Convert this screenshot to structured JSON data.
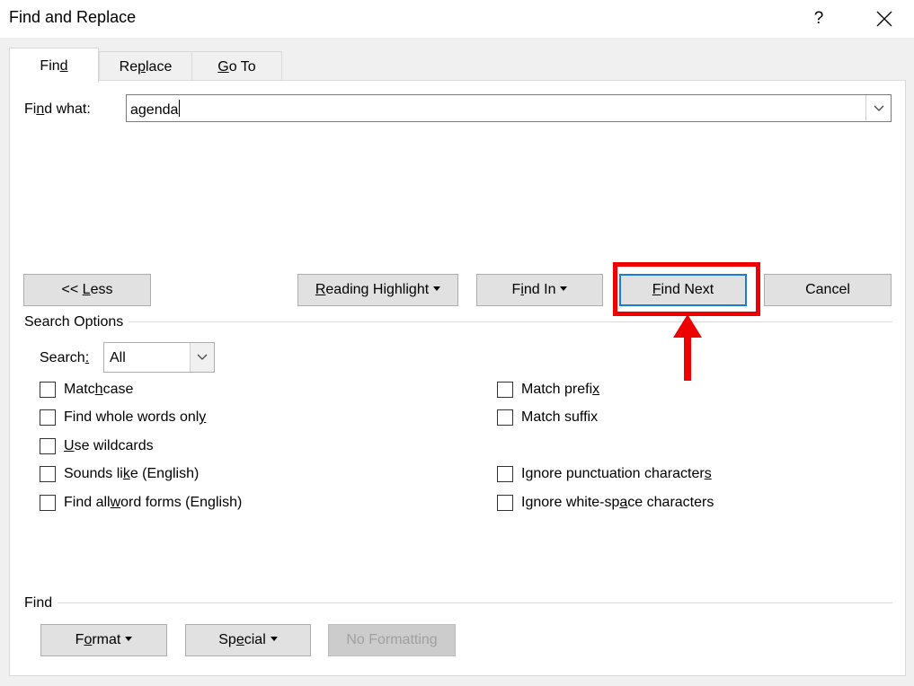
{
  "window": {
    "title": "Find and Replace",
    "help_label": "?"
  },
  "tabs": [
    {
      "pre": "Fin",
      "key": "d",
      "post": "",
      "active": true
    },
    {
      "pre": "Re",
      "key": "p",
      "post": "lace",
      "active": false
    },
    {
      "pre": "",
      "key": "G",
      "post": "o To",
      "active": false
    }
  ],
  "find_what": {
    "label_pre": "Fi",
    "label_key": "n",
    "label_post": "d what:",
    "value": "agenda"
  },
  "buttons": {
    "less": {
      "pre": "<< ",
      "key": "L",
      "post": "ess"
    },
    "reading_highlight": {
      "pre": "",
      "key": "R",
      "post": "eading Highlight"
    },
    "find_in": {
      "pre": "F",
      "key": "i",
      "post": "nd In"
    },
    "find_next": {
      "pre": "",
      "key": "F",
      "post": "ind Next"
    },
    "cancel": {
      "label": "Cancel"
    }
  },
  "search_options": {
    "group_label": "Search Options",
    "search_label_pre": "Search",
    "search_label_key": ":",
    "search_label_post": "",
    "search_value": "All",
    "left_checkboxes": [
      {
        "pre": "Matc",
        "key": "h",
        "post": " case",
        "checked": false
      },
      {
        "pre": "Find whole words onl",
        "key": "y",
        "post": "",
        "checked": false
      },
      {
        "pre": "",
        "key": "U",
        "post": "se wildcards",
        "checked": false
      },
      {
        "pre": "Sounds li",
        "key": "k",
        "post": "e (English)",
        "checked": false
      },
      {
        "pre": "Find all ",
        "key": "w",
        "post": "ord forms (English)",
        "checked": false
      }
    ],
    "right_checkboxes": [
      {
        "pre": "Match prefi",
        "key": "x",
        "post": "",
        "checked": false
      },
      {
        "pre": "Match suffix",
        "key": "",
        "post": "",
        "checked": false
      },
      {
        "pre": "Ignore punctuation character",
        "key": "s",
        "post": "",
        "checked": false
      },
      {
        "pre": "Ignore white-sp",
        "key": "a",
        "post": "ce characters",
        "checked": false
      }
    ]
  },
  "find_group": {
    "group_label": "Find",
    "format": {
      "pre": "F",
      "key": "o",
      "post": "rmat"
    },
    "special": {
      "pre": "Sp",
      "key": "e",
      "post": "cial"
    },
    "no_formatting": {
      "label": "No Formatting"
    }
  },
  "annotation": {
    "color": "#ee0000"
  }
}
